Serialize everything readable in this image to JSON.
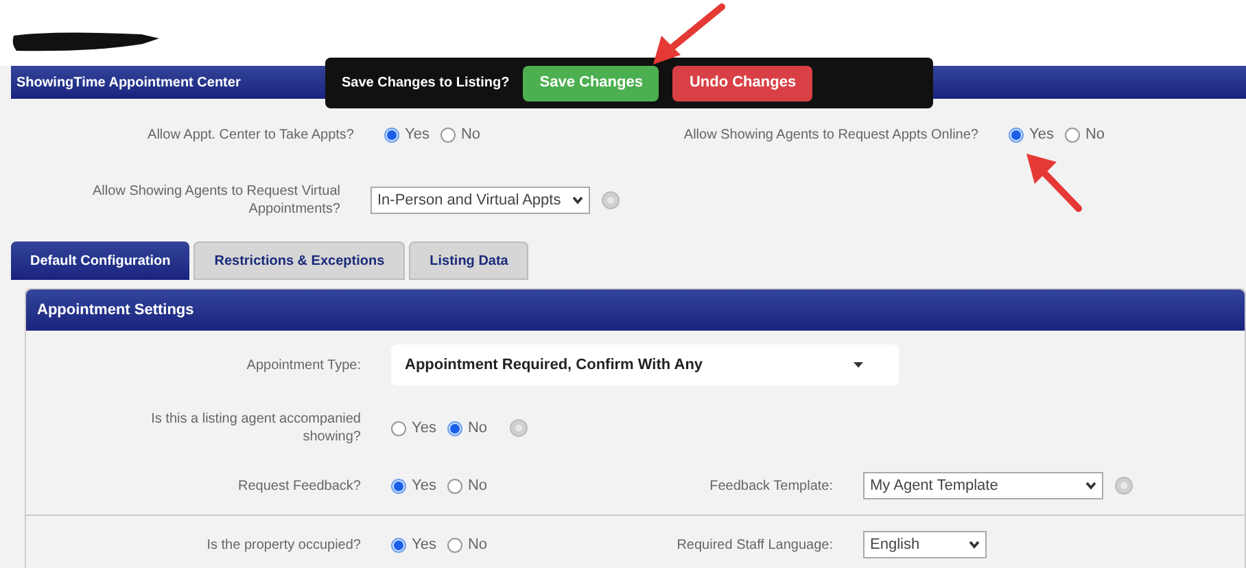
{
  "header": {
    "title": "ShowingTime Appointment Center"
  },
  "save_bar": {
    "prompt": "Save Changes to Listing?",
    "buttons": [
      {
        "label": "Save Changes",
        "kind": "save"
      },
      {
        "label": "Undo Changes",
        "kind": "undo"
      }
    ]
  },
  "top_rows": [
    {
      "left": {
        "label": "Allow Appt. Center to Take Appts?",
        "kind": "radio",
        "options": [
          {
            "label": "Yes",
            "selected": true
          },
          {
            "label": "No",
            "selected": false
          }
        ]
      },
      "right": {
        "label": "Allow Showing Agents to Request Appts Online?",
        "kind": "radio",
        "options": [
          {
            "label": "Yes",
            "selected": true
          },
          {
            "label": "No",
            "selected": false
          }
        ]
      }
    },
    {
      "left": {
        "label": "Allow Showing Agents to Request Virtual Appointments?",
        "kind": "select",
        "value": "In-Person and Virtual Appts",
        "help": true
      }
    }
  ],
  "tabs": [
    {
      "label": "Default Configuration",
      "selected": true
    },
    {
      "label": "Restrictions & Exceptions",
      "selected": false
    },
    {
      "label": "Listing Data",
      "selected": false
    }
  ],
  "panel": {
    "title": "Appointment Settings",
    "rows": [
      {
        "left": {
          "label": "Appointment Type:",
          "kind": "dropdown",
          "value": "Appointment Required, Confirm With Any"
        }
      },
      {
        "left": {
          "label": "Is this a listing agent accompanied showing?",
          "kind": "radio",
          "options": [
            {
              "label": "Yes",
              "selected": false
            },
            {
              "label": "No",
              "selected": true
            }
          ],
          "help": true
        }
      },
      {
        "left": {
          "label": "Request Feedback?",
          "kind": "radio",
          "options": [
            {
              "label": "Yes",
              "selected": true
            },
            {
              "label": "No",
              "selected": false
            }
          ]
        },
        "right": {
          "label": "Feedback Template:",
          "kind": "select",
          "value": "My Agent Template",
          "help": true,
          "wide": true
        }
      },
      {
        "divided": true,
        "left": {
          "label": "Is the property occupied?",
          "kind": "radio",
          "options": [
            {
              "label": "Yes",
              "selected": true
            },
            {
              "label": "No",
              "selected": false
            }
          ]
        },
        "right": {
          "label": "Required Staff Language:",
          "kind": "select",
          "value": "English"
        }
      }
    ]
  }
}
